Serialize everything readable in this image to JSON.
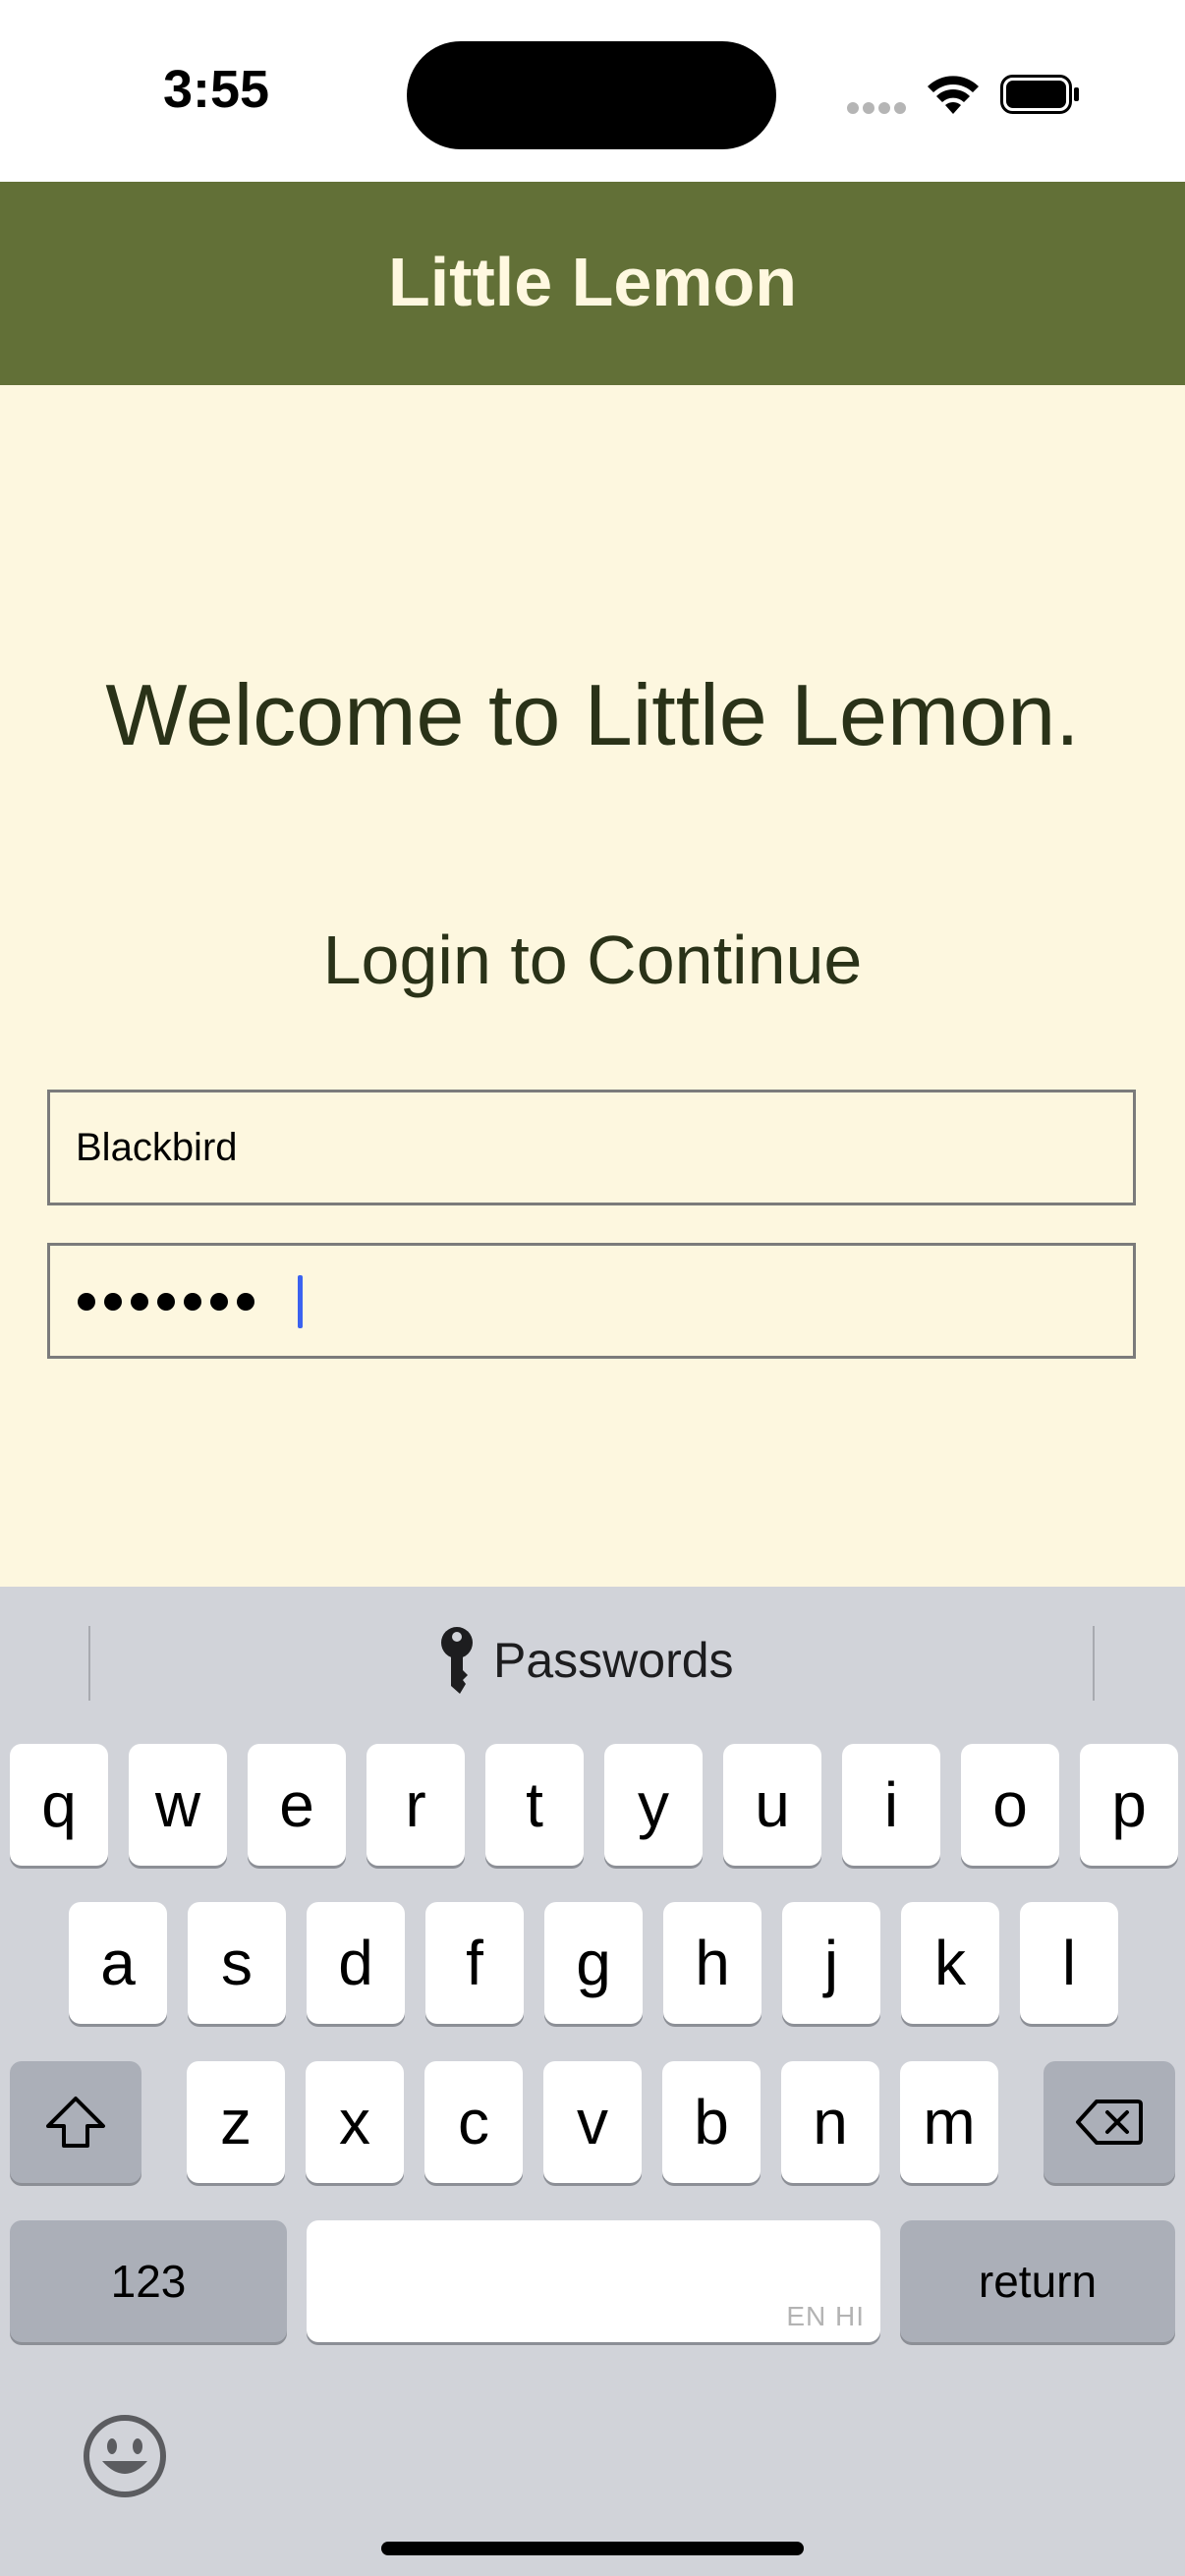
{
  "status_bar": {
    "time": "3:55"
  },
  "header": {
    "title": "Little Lemon"
  },
  "main": {
    "welcome": "Welcome to Little Lemon.",
    "subtitle": "Login to Continue",
    "username": {
      "value": "Blackbird"
    },
    "password": {
      "masked_length": 7
    }
  },
  "keyboard": {
    "passwords_label": "Passwords",
    "row1": [
      "q",
      "w",
      "e",
      "r",
      "t",
      "y",
      "u",
      "i",
      "o",
      "p"
    ],
    "row2": [
      "a",
      "s",
      "d",
      "f",
      "g",
      "h",
      "j",
      "k",
      "l"
    ],
    "row3": [
      "z",
      "x",
      "c",
      "v",
      "b",
      "n",
      "m"
    ],
    "numbers_label": "123",
    "return_label": "return",
    "space_language": "EN HI"
  },
  "colors": {
    "header_bg": "#627037",
    "content_bg": "#fdf7df",
    "caret": "#3b62f0"
  }
}
